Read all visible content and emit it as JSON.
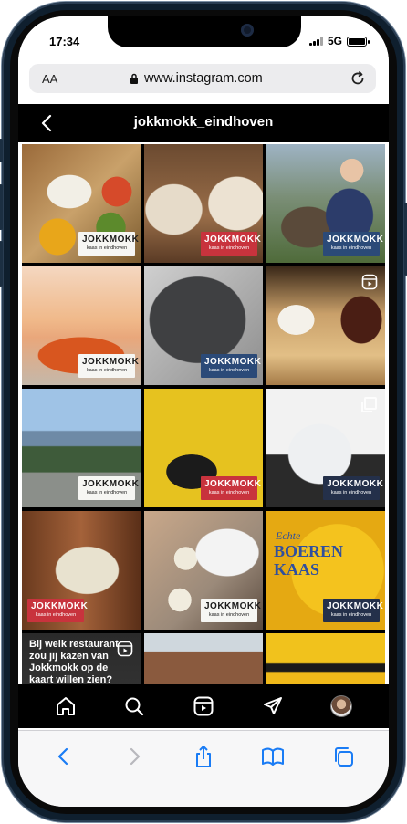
{
  "status_bar": {
    "time": "17:34",
    "network": "5G"
  },
  "browser": {
    "text_size_label": "AA",
    "url": "www.instagram.com"
  },
  "instagram": {
    "profile_title": "jokkmokk_eindhoven",
    "brand": {
      "name": "JOKKMOKK",
      "tagline": "kaas in eindhoven"
    },
    "reel_caption": "Bij welk restaurant zou jij kazen van Jokkmokk op de kaart willen zien?",
    "cheese_label_top": "Echte",
    "cheese_label_main": "BOEREN KAAS"
  },
  "colors": {
    "instagram_background": "#000000",
    "safari_accent": "#1a7cf5",
    "brand_red": "#c8333d",
    "brand_blue": "#2b4a78"
  },
  "icons": {
    "ig_nav": [
      "home-icon",
      "search-icon",
      "reels-icon",
      "send-icon",
      "profile-avatar"
    ],
    "safari_toolbar": [
      "back-arrow-icon",
      "forward-arrow-icon",
      "share-icon",
      "bookmarks-icon",
      "tabs-icon"
    ]
  }
}
